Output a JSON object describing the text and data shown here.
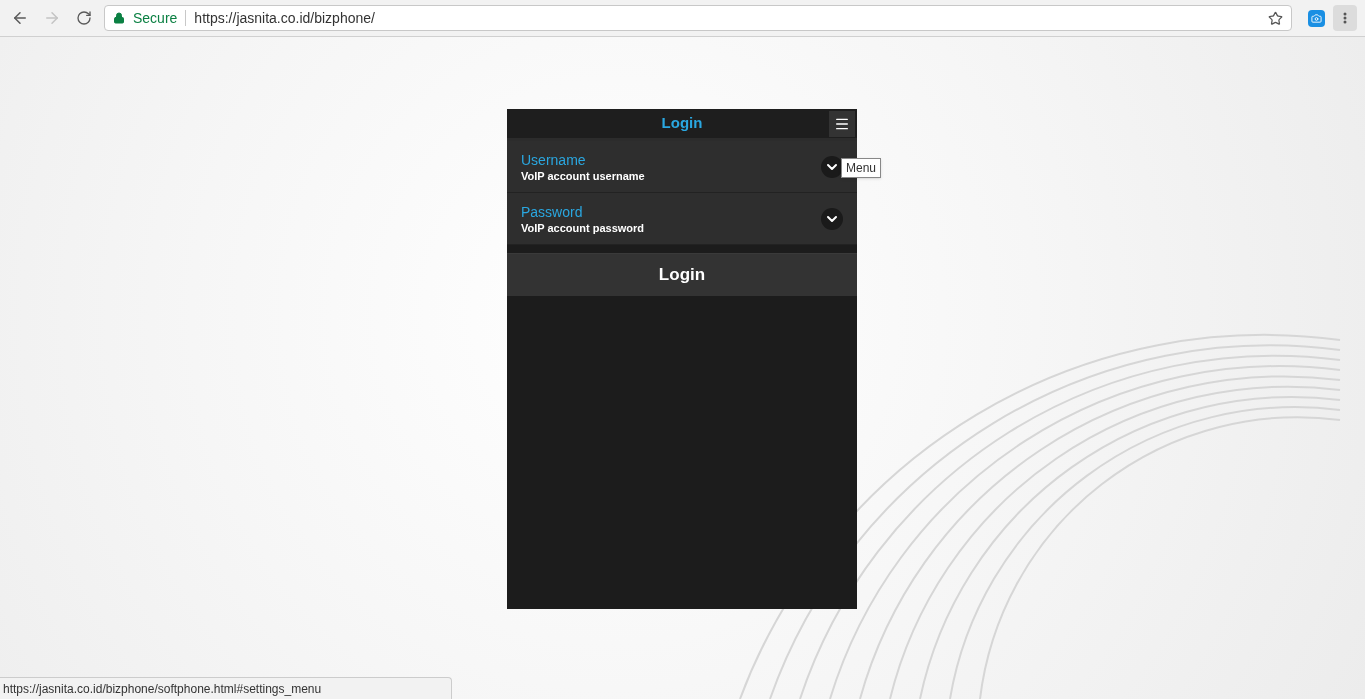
{
  "browser": {
    "security_label": "Secure",
    "url": "https://jasnita.co.id/bizphone/"
  },
  "app": {
    "title": "Login",
    "menu_tooltip": "Menu",
    "fields": [
      {
        "label": "Username",
        "description": "VoIP account username",
        "expanded": false
      },
      {
        "label": "Password",
        "description": "VoIP account password",
        "expanded": false
      }
    ],
    "login_button": "Login"
  },
  "status_bar": {
    "link": "https://jasnita.co.id/bizphone/softphone.html#settings_menu"
  }
}
